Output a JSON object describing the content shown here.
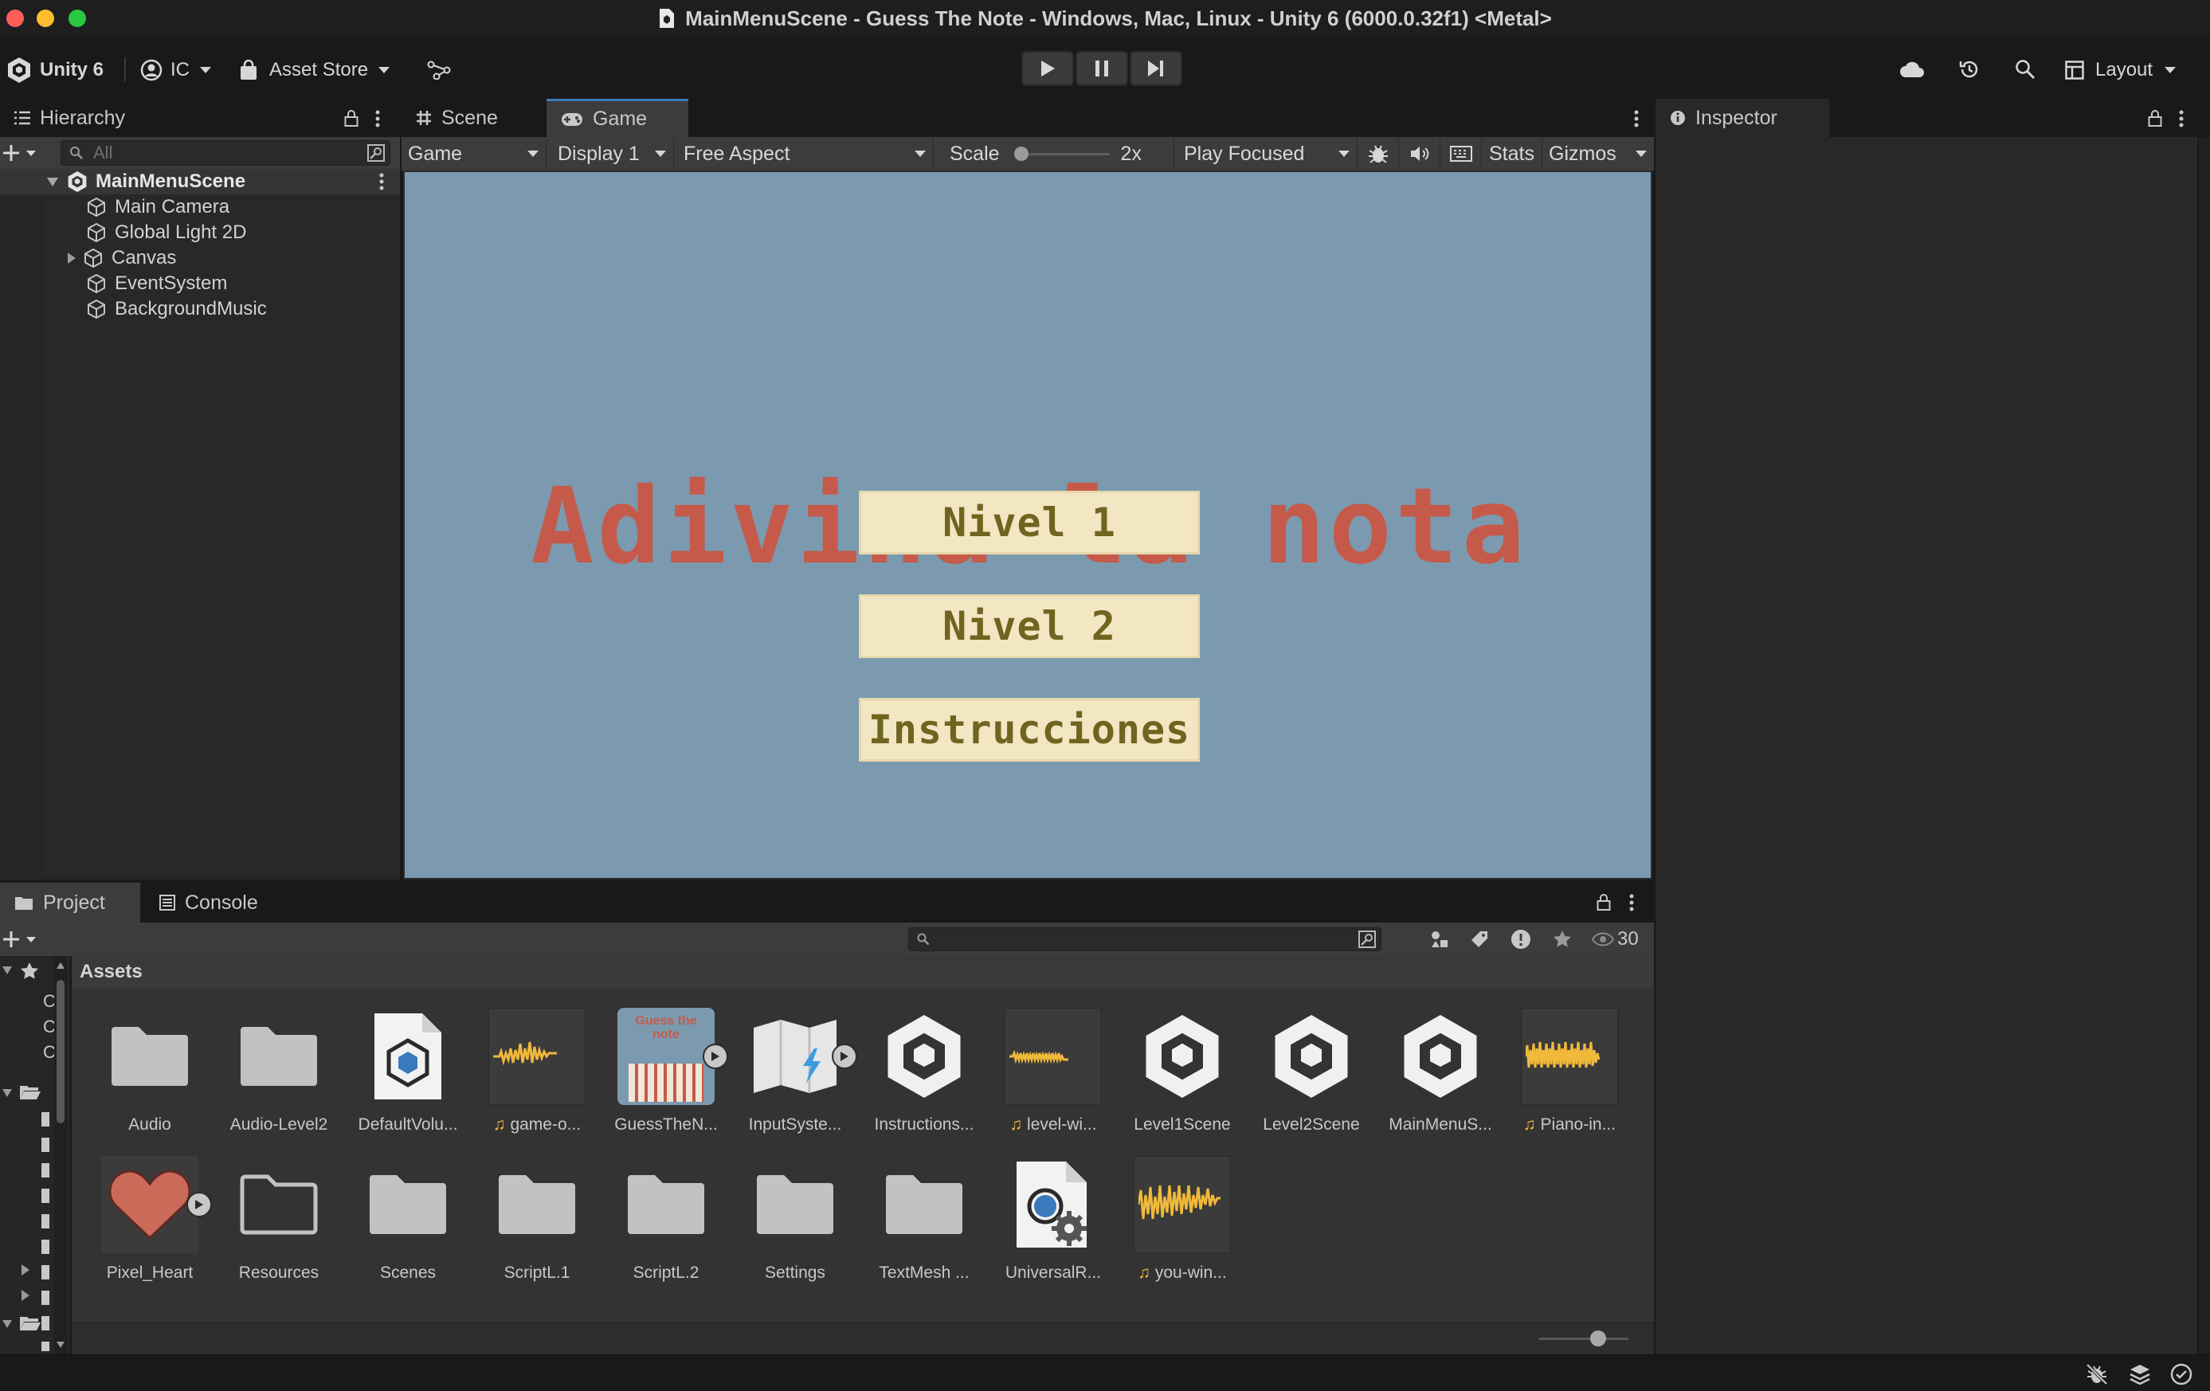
{
  "window": {
    "title": "MainMenuScene - Guess The Note - Windows, Mac, Linux - Unity 6 (6000.0.32f1) <Metal>"
  },
  "toolbar": {
    "unity_label": "Unity 6",
    "account_label": "IC",
    "asset_store_label": "Asset Store",
    "layout_label": "Layout"
  },
  "hierarchy": {
    "tab_label": "Hierarchy",
    "search_placeholder": "All",
    "scene_name": "MainMenuScene",
    "items": [
      "Main Camera",
      "Global Light 2D",
      "Canvas",
      "EventSystem",
      "BackgroundMusic"
    ]
  },
  "center_tabs": {
    "scene": "Scene",
    "game": "Game"
  },
  "game_toolbar": {
    "mode": "Game",
    "display": "Display 1",
    "aspect": "Free Aspect",
    "scale_label": "Scale",
    "scale_value": "2x",
    "play_mode": "Play Focused",
    "stats": "Stats",
    "gizmos": "Gizmos"
  },
  "game": {
    "title": "Adivina la nota",
    "buttons": [
      "Nivel 1",
      "Nivel 2",
      "Instrucciones"
    ]
  },
  "inspector": {
    "tab_label": "Inspector"
  },
  "bottom_tabs": {
    "project": "Project",
    "console": "Console"
  },
  "project": {
    "hidden_count": "30",
    "breadcrumb": "Assets",
    "assets_row1": [
      "Audio",
      "Audio-Level2",
      "DefaultVolu...",
      "game-o...",
      "GuessTheN...",
      "InputSyste...",
      "Instructions...",
      "level-wi...",
      "Level1Scene",
      "Level2Scene",
      "MainMenuS...",
      "Piano-in..."
    ],
    "assets_row2": [
      "Pixel_Heart",
      "Resources",
      "Scenes",
      "ScriptL.1",
      "ScriptL.2",
      "Settings",
      "TextMesh ...",
      "UniversalR...",
      "you-win..."
    ],
    "thumb_text": "Guess the note"
  },
  "colors": {
    "accent": "#3a79bb",
    "game_bg": "#7b9aaf",
    "title_red": "#c55a4a",
    "button_bg": "#f2e6c3",
    "button_text": "#6e6620",
    "audio_wave": "#f0b93a"
  }
}
